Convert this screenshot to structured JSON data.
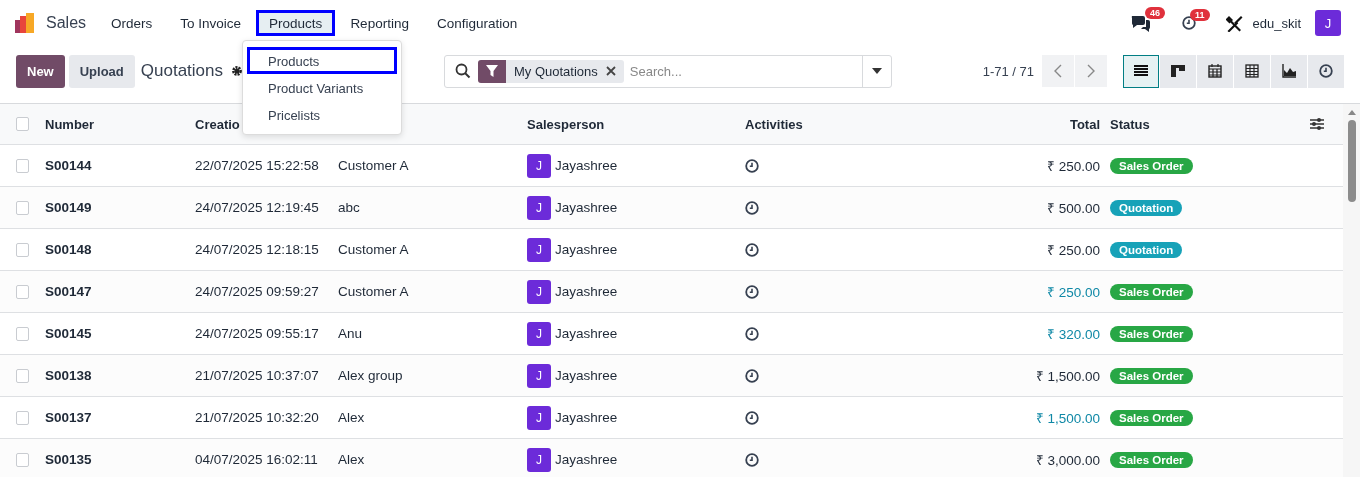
{
  "app": {
    "name": "Sales"
  },
  "menu": [
    {
      "label": "Orders",
      "open": false,
      "highlighted": false
    },
    {
      "label": "To Invoice",
      "open": false,
      "highlighted": false
    },
    {
      "label": "Products",
      "open": true,
      "highlighted": true
    },
    {
      "label": "Reporting",
      "open": false,
      "highlighted": false
    },
    {
      "label": "Configuration",
      "open": false,
      "highlighted": false
    }
  ],
  "dropdown": [
    {
      "label": "Products",
      "highlighted": true
    },
    {
      "label": "Product Variants",
      "highlighted": false
    },
    {
      "label": "Pricelists",
      "highlighted": false
    }
  ],
  "systray": {
    "messages_count": "46",
    "activities_count": "11",
    "user": "edu_skit",
    "avatar": "J"
  },
  "control_panel": {
    "buttons": [
      {
        "label": "New",
        "kind": "primary"
      },
      {
        "label": "Upload",
        "kind": "secondary"
      }
    ],
    "title": "Quotations",
    "filter": "My Quotations",
    "search_placeholder": "Search...",
    "pager": "1-71 / 71",
    "views": [
      {
        "kind": "list",
        "selected": true
      },
      {
        "kind": "kanban",
        "selected": false
      },
      {
        "kind": "calendar",
        "selected": false
      },
      {
        "kind": "pivot",
        "selected": false
      },
      {
        "kind": "graph",
        "selected": false
      },
      {
        "kind": "activity",
        "selected": false
      }
    ]
  },
  "table": {
    "select_all_checked": false,
    "columns": [
      "Number",
      "Creatio",
      "",
      "Salesperson",
      "Activities",
      "Total",
      "Status"
    ],
    "rows": [
      {
        "checked": false,
        "number": "S00144",
        "created": "22/07/2025 15:22:58",
        "customer": "Customer A",
        "avatar": "J",
        "salesperson": "Jayashree",
        "total": "₹ 250.00",
        "total_highlighted": false,
        "status": "Sales Order",
        "color": "#28a745"
      },
      {
        "checked": false,
        "number": "S00149",
        "created": "24/07/2025 12:19:45",
        "customer": "abc",
        "avatar": "J",
        "salesperson": "Jayashree",
        "total": "₹ 500.00",
        "total_highlighted": false,
        "status": "Quotation",
        "color": "#17a2b8"
      },
      {
        "checked": false,
        "number": "S00148",
        "created": "24/07/2025 12:18:15",
        "customer": "Customer A",
        "avatar": "J",
        "salesperson": "Jayashree",
        "total": "₹ 250.00",
        "total_highlighted": false,
        "status": "Quotation",
        "color": "#17a2b8"
      },
      {
        "checked": false,
        "number": "S00147",
        "created": "24/07/2025 09:59:27",
        "customer": "Customer A",
        "avatar": "J",
        "salesperson": "Jayashree",
        "total": "₹ 250.00",
        "total_highlighted": true,
        "status": "Sales Order",
        "color": "#28a745"
      },
      {
        "checked": false,
        "number": "S00145",
        "created": "24/07/2025 09:55:17",
        "customer": "Anu",
        "avatar": "J",
        "salesperson": "Jayashree",
        "total": "₹ 320.00",
        "total_highlighted": true,
        "status": "Sales Order",
        "color": "#28a745"
      },
      {
        "checked": false,
        "number": "S00138",
        "created": "21/07/2025 10:37:07",
        "customer": "Alex group",
        "avatar": "J",
        "salesperson": "Jayashree",
        "total": "₹ 1,500.00",
        "total_highlighted": false,
        "status": "Sales Order",
        "color": "#28a745"
      },
      {
        "checked": false,
        "number": "S00137",
        "created": "21/07/2025 10:32:20",
        "customer": "Alex",
        "avatar": "J",
        "salesperson": "Jayashree",
        "total": "₹ 1,500.00",
        "total_highlighted": true,
        "status": "Sales Order",
        "color": "#28a745"
      },
      {
        "checked": false,
        "number": "S00135",
        "created": "04/07/2025 16:02:11",
        "customer": "Alex",
        "avatar": "J",
        "salesperson": "Jayashree",
        "total": "₹ 3,000.00",
        "total_highlighted": false,
        "status": "Sales Order",
        "color": "#28a745"
      }
    ]
  }
}
